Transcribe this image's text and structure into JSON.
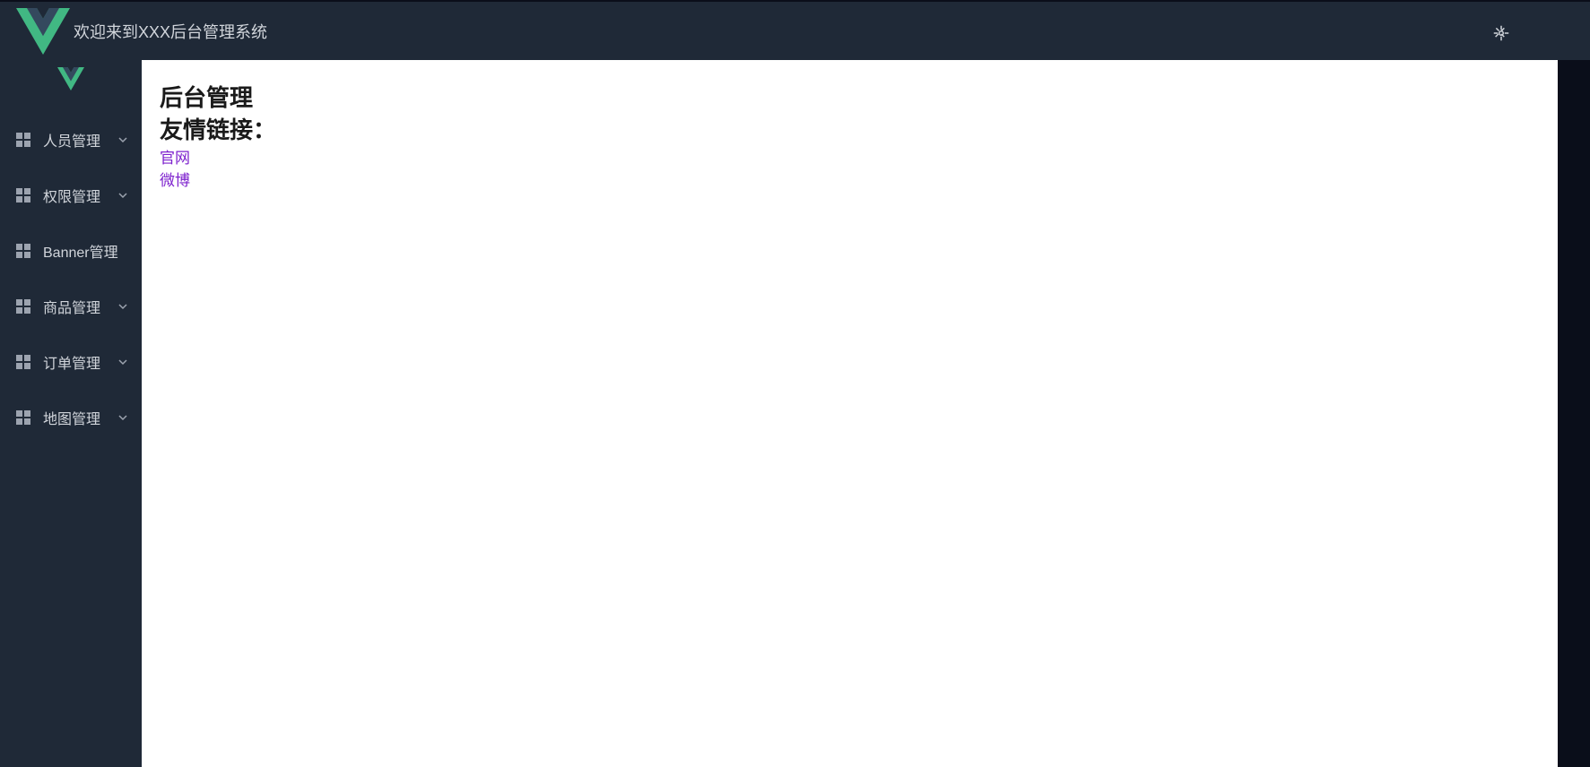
{
  "header": {
    "title": "欢迎来到XXX后台管理系统"
  },
  "sidebar": {
    "items": [
      {
        "label": "人员管理",
        "expandable": true
      },
      {
        "label": "权限管理",
        "expandable": true
      },
      {
        "label": "Banner管理",
        "expandable": false
      },
      {
        "label": "商品管理",
        "expandable": true
      },
      {
        "label": "订单管理",
        "expandable": true
      },
      {
        "label": "地图管理",
        "expandable": true
      }
    ]
  },
  "main": {
    "heading1": "后台管理",
    "heading2": "友情链接：",
    "links": [
      {
        "label": "官网"
      },
      {
        "label": "微博"
      }
    ]
  }
}
